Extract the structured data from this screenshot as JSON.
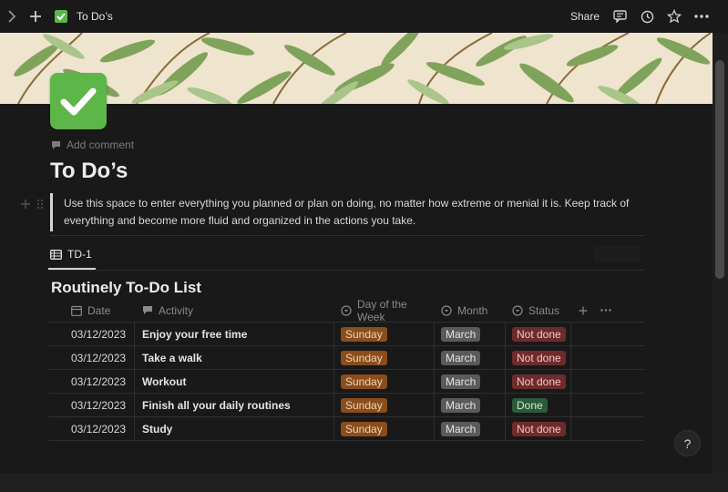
{
  "topbar": {
    "title": "To Do’s",
    "share_label": "Share",
    "icons": [
      "chevron-right-icon",
      "plus-icon",
      "check-emoji-icon",
      "comment-icon",
      "history-icon",
      "star-icon",
      "more-icon"
    ]
  },
  "page": {
    "add_comment": "Add comment",
    "title": "To Do’s",
    "quote": "Use this space to enter everything you planned or plan on doing, no matter how extreme or menial it is. Keep track of everything and become more fluid and organized in the actions you take."
  },
  "view": {
    "tab_label": "TD-1"
  },
  "database": {
    "title": "Routinely To-Do List",
    "columns": [
      "Date",
      "Activity",
      "Day of the Week",
      "Month",
      "Status"
    ],
    "rows": [
      {
        "date": "03/12/2023",
        "activity": "Enjoy your free time",
        "day": "Sunday",
        "month": "March",
        "status": "Not done"
      },
      {
        "date": "03/12/2023",
        "activity": "Take a walk",
        "day": "Sunday",
        "month": "March",
        "status": "Not done"
      },
      {
        "date": "03/12/2023",
        "activity": "Workout",
        "day": "Sunday",
        "month": "March",
        "status": "Not done"
      },
      {
        "date": "03/12/2023",
        "activity": "Finish all your daily routines",
        "day": "Sunday",
        "month": "March",
        "status": "Done"
      },
      {
        "date": "03/12/2023",
        "activity": "Study",
        "day": "Sunday",
        "month": "March",
        "status": "Not done"
      }
    ]
  },
  "help_label": "?",
  "colors": {
    "background": "#191919",
    "tag_sunday": "#8a4d1c",
    "tag_march": "#5a5a5a",
    "tag_not_done": "#6e2b2b",
    "tag_done": "#2b5b3a",
    "page_icon": "#5cb648"
  }
}
